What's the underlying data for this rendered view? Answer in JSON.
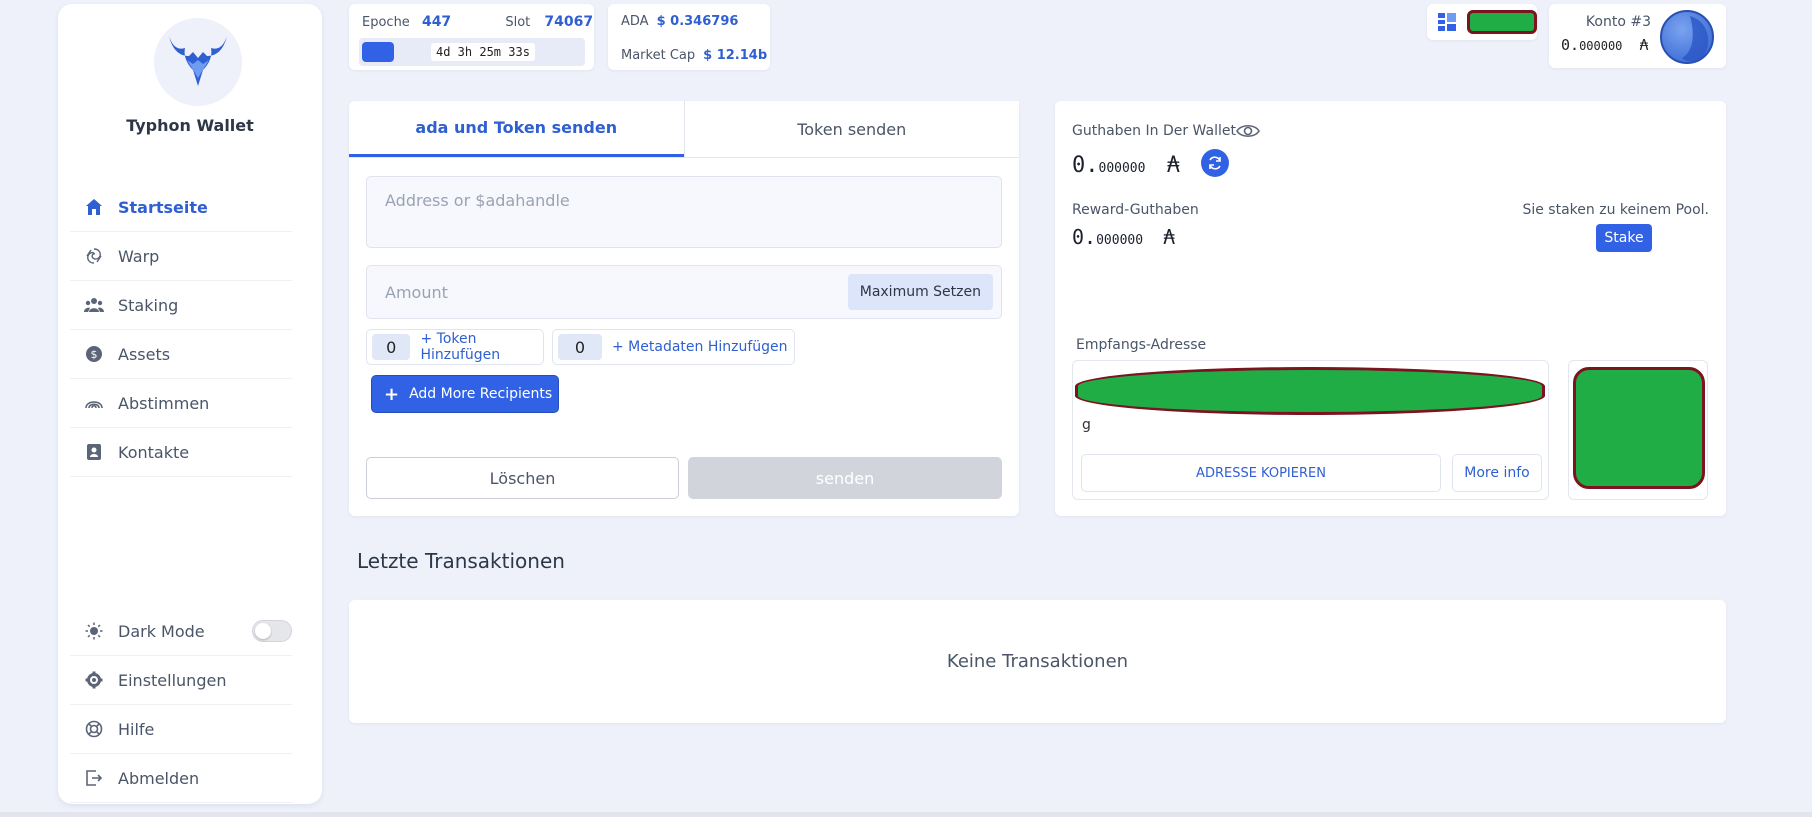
{
  "sidebar": {
    "wallet_name": "Typhon Wallet",
    "nav": [
      {
        "label": "Startseite",
        "icon": "home-icon",
        "active": true
      },
      {
        "label": "Warp",
        "icon": "spiral-icon"
      },
      {
        "label": "Staking",
        "icon": "people-icon"
      },
      {
        "label": "Assets",
        "icon": "coin-icon"
      },
      {
        "label": "Abstimmen",
        "icon": "vote-icon"
      },
      {
        "label": "Kontakte",
        "icon": "contacts-icon"
      }
    ],
    "bottom": [
      {
        "label": "Dark Mode",
        "icon": "sun-icon",
        "toggle": false
      },
      {
        "label": "Einstellungen",
        "icon": "gear-icon"
      },
      {
        "label": "Hilfe",
        "icon": "lifebuoy-icon"
      },
      {
        "label": "Abmelden",
        "icon": "logout-icon"
      }
    ]
  },
  "epoch": {
    "epoch_label": "Epoche",
    "epoch_value": "447",
    "slot_label": "Slot",
    "slot_value": "74067",
    "progress": 0.14,
    "remaining": "4d 3h 25m 33s"
  },
  "price": {
    "ada_label": "ADA",
    "ada_value": "$ 0.346796",
    "mcap_label": "Market Cap",
    "mcap_value": "$ 12.14b"
  },
  "account": {
    "title": "Konto #3",
    "balance_int": "0.",
    "balance_dec": "000000",
    "currency": "₳"
  },
  "send": {
    "tab_ada": "ada und Token senden",
    "tab_token": "Token senden",
    "address_placeholder": "Address or $adahandle",
    "amount_placeholder": "Amount",
    "max_label": "Maximum Setzen",
    "token_count": "0",
    "token_add": "+ Token Hinzufügen",
    "meta_count": "0",
    "meta_add": "+ Metadaten Hinzufügen",
    "add_recipients": "Add More Recipients",
    "clear": "Löschen",
    "send": "senden"
  },
  "balance": {
    "wallet_label": "Guthaben In Der Wallet",
    "wallet_int": "0.",
    "wallet_dec": "000000",
    "currency": "₳",
    "reward_label": "Reward-Guthaben",
    "reward_int": "0.",
    "reward_dec": "000000",
    "stake_status": "Sie staken zu keinem Pool.",
    "stake_button": "Stake",
    "receive_label": "Empfangs-Adresse",
    "address_tail": "g",
    "copy_button": "ADRESSE KOPIEREN",
    "more_info": "More info"
  },
  "transactions": {
    "title": "Letzte Transaktionen",
    "empty": "Keine Transaktionen"
  },
  "colors": {
    "accent": "#3162e6",
    "redaction_fill": "#21ad45",
    "redaction_border": "#7b1320"
  }
}
